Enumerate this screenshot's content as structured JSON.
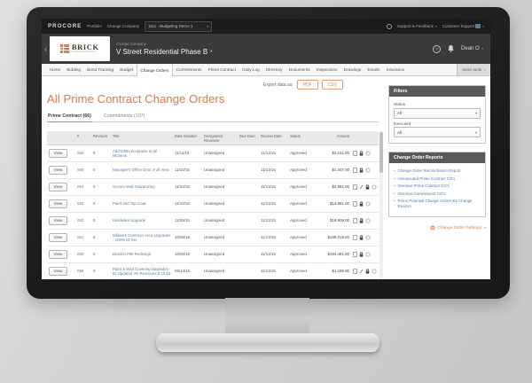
{
  "colors": {
    "accent_orange": "#E8744A",
    "link_blue": "#4C7FAE",
    "panel_header_gray": "#59595B",
    "topbar_black": "#1B1B1D",
    "header_charcoal": "#3A3A3C"
  },
  "global_nav": {
    "brand": "PROCORE",
    "portfolio": "Portfolio",
    "change_company": "Change Company",
    "project_selector": "1111 - Budgeting Demo 1",
    "support_feedback": "Support & Feedback",
    "customer_support": "Customer Support",
    "user": "Dean O"
  },
  "project_header": {
    "logo_name": "BRICK",
    "logo_sub": "CONSTRUCTION",
    "change_company_label": "Change Company",
    "project_name": "V Street Residential Phase B",
    "help": "?"
  },
  "toolbar": {
    "tabs": [
      "Home",
      "Bidding",
      "Bond Tracking",
      "Budget",
      "Change Orders",
      "Commitments",
      "Prime Contract",
      "Daily Log",
      "Directory",
      "Documents",
      "Inspections",
      "Drawings",
      "Emails",
      "Insurance"
    ],
    "active_tab": "Change Orders",
    "more_tools": "more tools"
  },
  "page": {
    "title": "All Prime Contract Change Orders",
    "export_label": "Export data as:",
    "export_pdf": "PDF",
    "export_csv": "CSV",
    "tabs": [
      {
        "label": "Prime Contract (66)",
        "active": true
      },
      {
        "label": "Commitments (107)",
        "active": false
      }
    ]
  },
  "table": {
    "headers": [
      "",
      "#",
      "Revision",
      "Title",
      "Date Initiated",
      "Designated Reviewer",
      "Due Date",
      "Review Date",
      "Status",
      "Amount",
      ""
    ],
    "view_button": "View",
    "rows": [
      {
        "num": "066",
        "revision": "0",
        "title": "Add USB receptacle to all kitchens",
        "date_initiated": "11/11/15",
        "designated_reviewer": "Unassigned",
        "due_date": "",
        "review_date": "11/13/15",
        "status": "Approved",
        "amount": "$3,161.00",
        "has_attachment": false
      },
      {
        "num": "065",
        "revision": "0",
        "title": "Manager's Office Door, Full View",
        "date_initiated": "11/10/15",
        "designated_reviewer": "Unassigned",
        "due_date": "",
        "review_date": "11/13/15",
        "status": "Approved",
        "amount": "$1,407.00",
        "has_attachment": false
      },
      {
        "num": "064",
        "revision": "0",
        "title": "Screen Wall Galvanizing",
        "date_initiated": "11/10/15",
        "designated_reviewer": "Unassigned",
        "due_date": "",
        "review_date": "11/13/15",
        "status": "Approved",
        "amount": "$2,982.00",
        "has_attachment": true
      },
      {
        "num": "063",
        "revision": "0",
        "title": "Paint 2nd Top Coat",
        "date_initiated": "11/10/15",
        "designated_reviewer": "Unassigned",
        "due_date": "",
        "review_date": "11/13/15",
        "status": "Approved",
        "amount": "$13,881.00",
        "has_attachment": false
      },
      {
        "num": "062",
        "revision": "0",
        "title": "Hardware Upgrade",
        "date_initiated": "11/09/15",
        "designated_reviewer": "Unassigned",
        "due_date": "",
        "review_date": "11/13/15",
        "status": "Approved",
        "amount": "$18,909.00",
        "has_attachment": false
      },
      {
        "num": "061",
        "revision": "0",
        "title": "Millwork Common Area Upgrades - 100% ID Set",
        "date_initiated": "10/26/15",
        "designated_reviewer": "Unassigned",
        "due_date": "",
        "review_date": "11/13/15",
        "status": "Approved",
        "amount": "$189,018.00",
        "has_attachment": false
      },
      {
        "num": "060",
        "revision": "0",
        "title": "Bracket Pile Redesign",
        "date_initiated": "10/26/15",
        "designated_reviewer": "Unassigned",
        "due_date": "",
        "review_date": "11/13/15",
        "status": "Approved",
        "amount": "$194,491.82",
        "has_attachment": false
      },
      {
        "num": "059",
        "revision": "0",
        "title": "Paint & Wall Covering Upgrades - ID Updated VE Revisions 8 10.15",
        "date_initiated": "09/14/15",
        "designated_reviewer": "Unassigned",
        "due_date": "",
        "review_date": "11/13/15",
        "status": "Approved",
        "amount": "$1,439.00",
        "has_attachment": true
      }
    ]
  },
  "filters": {
    "title": "Filters",
    "fields": [
      {
        "label": "Status",
        "value": "All"
      },
      {
        "label": "Executed",
        "value": "All"
      }
    ]
  },
  "reports": {
    "title": "Change Order Reports",
    "links": [
      "Change Order Reconciliation Report",
      "Unexecuted Prime Contract CO's",
      "Overdue Prime Contract CO's",
      "Overdue Commitment CO's",
      "Prime Potential Change Orders By Change Reason"
    ]
  },
  "settings": {
    "label": "Change Order Settings"
  }
}
